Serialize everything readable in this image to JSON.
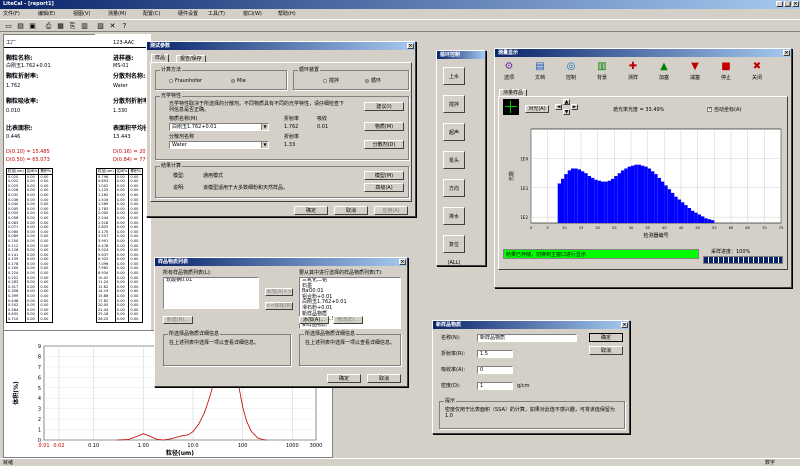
{
  "app": {
    "title": "LiteCal - [report1]",
    "menu": [
      "文件(F)",
      "编辑(E)",
      "视图(V)",
      "测量(M)",
      "配置(C)",
      "硬件设置",
      "工具(T)",
      "窗口(W)",
      "帮助(H)"
    ],
    "statusbar": {
      "left": "就绪",
      "right": "数字"
    },
    "toolbar_icons": [
      "new-icon",
      "open-icon",
      "save-icon",
      "print-icon",
      "preview-icon",
      "copy-icon",
      "paste-icon",
      "report-icon",
      "delete-icon",
      "help-icon"
    ]
  },
  "report": {
    "org": "工厂",
    "sample_id": "123-AAC",
    "sample_name_label": "颗粒名称:",
    "sample_name": "白刚玉1.762+0.01",
    "source_label": "进样器:",
    "source": "MS-01",
    "refr_label": "颗粒折射率:",
    "refr": "1.762",
    "disp_label": "分散剂名称:",
    "disp": "Water",
    "absorb_label": "颗粒吸收率:",
    "absorb": "0.010",
    "disp_refr_label": "分散剂折射率:",
    "disp_refr": "1.330",
    "ssa_label": "比表面积:",
    "ssa": "0.446",
    "surf_label": "表面积平均径:",
    "surf": "13.443",
    "d10": "D(0.10) = 15.485",
    "d16": "D(0.16) = 20.1",
    "d50": "D(0.50) = 65.073",
    "d84": "D(0.84) = 77.6",
    "table_headers": [
      "粒径(um)",
      "区间%",
      "累积%"
    ],
    "table1": [
      [
        "0.020",
        "0.00",
        "0.00"
      ],
      [
        "0.022",
        "0.00",
        "0.00"
      ],
      [
        "0.025",
        "0.00",
        "0.00"
      ],
      [
        "0.028",
        "0.00",
        "0.00"
      ],
      [
        "0.032",
        "0.00",
        "0.00"
      ],
      [
        "0.036",
        "0.00",
        "0.00"
      ],
      [
        "0.040",
        "0.00",
        "0.00"
      ],
      [
        "0.045",
        "0.00",
        "0.00"
      ],
      [
        "0.050",
        "0.00",
        "0.00"
      ],
      [
        "0.056",
        "0.00",
        "0.00"
      ],
      [
        "0.063",
        "0.00",
        "0.00"
      ],
      [
        "0.071",
        "0.00",
        "0.00"
      ],
      [
        "0.080",
        "0.00",
        "0.00"
      ],
      [
        "0.089",
        "0.00",
        "0.00"
      ],
      [
        "0.100",
        "0.00",
        "0.00"
      ],
      [
        "0.112",
        "0.00",
        "0.00"
      ],
      [
        "0.126",
        "0.00",
        "0.00"
      ],
      [
        "0.141",
        "0.00",
        "0.00"
      ],
      [
        "0.159",
        "0.00",
        "0.00"
      ],
      [
        "0.178",
        "0.00",
        "0.00"
      ],
      [
        "0.200",
        "0.00",
        "0.00"
      ],
      [
        "0.224",
        "0.00",
        "0.00"
      ],
      [
        "0.252",
        "0.00",
        "0.00"
      ],
      [
        "0.283",
        "0.00",
        "0.00"
      ],
      [
        "0.317",
        "0.00",
        "0.00"
      ],
      [
        "0.356",
        "0.00",
        "0.00"
      ],
      [
        "0.399",
        "0.00",
        "0.00"
      ],
      [
        "0.448",
        "0.00",
        "0.00"
      ],
      [
        "0.502",
        "0.00",
        "0.00"
      ],
      [
        "0.564",
        "0.00",
        "0.00"
      ],
      [
        "0.632",
        "0.00",
        "0.00"
      ],
      [
        "0.710",
        "0.00",
        "0.00"
      ]
    ],
    "table2": [
      [
        "0.796",
        "0.00",
        "0.00"
      ],
      [
        "0.893",
        "0.00",
        "0.00"
      ],
      [
        "1.002",
        "0.00",
        "0.00"
      ],
      [
        "1.125",
        "0.00",
        "0.00"
      ],
      [
        "1.262",
        "0.00",
        "0.00"
      ],
      [
        "1.416",
        "0.00",
        "0.00"
      ],
      [
        "1.589",
        "0.00",
        "0.00"
      ],
      [
        "1.783",
        "0.00",
        "0.00"
      ],
      [
        "2.000",
        "0.00",
        "0.00"
      ],
      [
        "2.244",
        "0.00",
        "0.00"
      ],
      [
        "2.518",
        "0.00",
        "0.00"
      ],
      [
        "2.825",
        "0.00",
        "0.00"
      ],
      [
        "3.170",
        "0.00",
        "0.00"
      ],
      [
        "3.557",
        "0.00",
        "0.00"
      ],
      [
        "3.991",
        "0.00",
        "0.00"
      ],
      [
        "4.478",
        "0.00",
        "0.00"
      ],
      [
        "5.024",
        "0.00",
        "0.00"
      ],
      [
        "5.637",
        "0.00",
        "0.00"
      ],
      [
        "6.325",
        "0.00",
        "0.00"
      ],
      [
        "7.096",
        "0.00",
        "0.00"
      ],
      [
        "7.962",
        "0.00",
        "0.00"
      ],
      [
        "8.934",
        "0.00",
        "0.00"
      ],
      [
        "10.02",
        "0.00",
        "0.00"
      ],
      [
        "11.24",
        "0.00",
        "0.00"
      ],
      [
        "12.62",
        "0.00",
        "0.00"
      ],
      [
        "14.15",
        "0.00",
        "0.00"
      ],
      [
        "15.88",
        "0.00",
        "0.00"
      ],
      [
        "17.82",
        "0.00",
        "0.00"
      ],
      [
        "20.00",
        "0.00",
        "0.00"
      ],
      [
        "22.44",
        "0.00",
        "0.00"
      ],
      [
        "25.18",
        "0.00",
        "0.00"
      ],
      [
        "28.25",
        "0.00",
        "0.00"
      ]
    ]
  },
  "dist_chart": {
    "ylabel": "体积(%)",
    "xlabel": "粒径(um)",
    "xticks": [
      "0.01",
      "0.02",
      "0.10",
      "1.00",
      "10.0",
      "100",
      "1000",
      "3000"
    ],
    "yticks": [
      "0",
      "1",
      "2",
      "3",
      "4",
      "5",
      "6",
      "7",
      "8",
      "9"
    ]
  },
  "chart_data": {
    "type": "area",
    "title": "",
    "xlabel": "粒径(um)",
    "ylabel": "体积(%)",
    "xscale": "log",
    "xlim": [
      0.01,
      3000
    ],
    "ylim": [
      0,
      9
    ],
    "x": [
      0.3,
      0.5,
      0.8,
      1.0,
      1.3,
      1.8,
      2.5,
      3.5,
      5,
      6,
      8,
      10,
      13,
      17,
      22,
      28,
      35,
      45,
      55,
      65,
      75,
      85,
      100,
      120,
      150,
      200,
      250,
      300
    ],
    "y": [
      0,
      0.05,
      0.4,
      0.6,
      0.4,
      0.1,
      0,
      0.1,
      0.3,
      0.4,
      0.5,
      0.8,
      1.5,
      2.6,
      4.2,
      6.0,
      7.4,
      8.2,
      8.2,
      7.6,
      6.4,
      5.0,
      3.2,
      1.8,
      0.8,
      0.2,
      0.05,
      0
    ]
  },
  "test_params": {
    "title": "测试参数",
    "tabs": [
      "样品",
      "报告/保存"
    ],
    "calc_group": "计算方法",
    "fraunhofer": "Fraunhofer",
    "mie": "Mie",
    "loop_group": "循环装置",
    "loop_opt1": "搅拌",
    "loop_opt2": "循环",
    "optical_group": "光学特性",
    "optical_desc": "光学特性取决于所选择的分散剂。不同物质具有不同的光学特性，请仔细检查下列信息是否正确。",
    "suggest_btn": "建议(I)",
    "material_label": "物质名称(M)",
    "material": "白刚玉1.762+0.01",
    "refr_label": "折射率",
    "refr": "1.762",
    "abs_label": "吸收",
    "abs": "0.01",
    "material_btn": "物质(M)",
    "dispersant_label": "分散剂名称",
    "dispersant": "Water",
    "disp_refr_label": "折射率",
    "disp_refr": "1.33",
    "dispersant_btn": "分散剂(D)",
    "result_group": "结果计算",
    "model_label": "模型:",
    "model": "通用模式",
    "model_btn": "模型(M)",
    "desc_label": "说明:",
    "desc": "该模型适用于大多数细粉和天然样品。",
    "advanced_btn": "高级(A)",
    "ok": "确定",
    "cancel": "取消",
    "apply": "应用(A)"
  },
  "sample_list": {
    "title": "样品物质列表",
    "all_label": "所有样品物质列表(L):",
    "all_items": [
      "软酸钠0.01"
    ],
    "selected_label": "要从其中进行选择的样品物质列表(T):",
    "selected_items": [
      "三氧化二铝",
      "石墨",
      "BaO0.01",
      "铝合粉+0.01",
      "白刚玉1.762+0.01",
      "滑石粉+0.01",
      "新样品物质",
      "新样品物质1.5",
      "新样品物质"
    ],
    "add_btn": "添加(A)>>",
    "remove_btn": "<<移除(R)",
    "new_btn": "新建(N)...",
    "add2_btn": "添加(A)...",
    "edit_btn": "修改(E)...",
    "all_info_group": "所选择品物质详细信息",
    "all_info": "在上述列表中选择一项以查看详细信息。",
    "sel_info_group": "所选择品物质详细信息",
    "sel_info": "在上述列表中选择一项以查看详细信息。",
    "ok": "确定",
    "cancel": "取消"
  },
  "loop_control": {
    "title": "循环控制",
    "buttons": [
      "上水",
      "搅拌",
      "超声",
      "泵头",
      "方向",
      "排水",
      "复位(ALL)"
    ]
  },
  "measure": {
    "title": "测量显示",
    "tools": [
      {
        "label": "选项",
        "icon": "options-icon",
        "color": "#7030a0"
      },
      {
        "label": "文档",
        "icon": "document-icon",
        "color": "#2060c0"
      },
      {
        "label": "控制",
        "icon": "control-icon",
        "color": "#0070c0"
      },
      {
        "label": "背景",
        "icon": "background-icon",
        "color": "#008000"
      },
      {
        "label": "测样",
        "icon": "measure-icon",
        "color": "#c00000"
      },
      {
        "label": "加塞",
        "icon": "add-icon",
        "color": "#008000"
      },
      {
        "label": "减塞",
        "icon": "subtract-icon",
        "color": "#c00000"
      },
      {
        "label": "停止",
        "icon": "stop-icon",
        "color": "#c00000"
      },
      {
        "label": "关闭",
        "icon": "close-icon",
        "color": "#c00000"
      }
    ],
    "tab": "测量样品",
    "align_btn": "对光(A)",
    "concentration": "遮光率光度 = 33.49%",
    "auto_adjust": "自动坐标(A)",
    "ylabel": "光能",
    "xlabel": "检测器编号",
    "yticks": [
      "1E4",
      "1E3",
      "1E2"
    ],
    "xticks": [
      "0",
      "5",
      "10",
      "15",
      "20",
      "25",
      "30",
      "35",
      "40",
      "45",
      "50",
      "55",
      "60",
      "65",
      "70",
      "75"
    ],
    "status": "结果已存储，切换到主窗口进行显示",
    "progress_label": "采样进度：100%",
    "progress": 1.0
  },
  "energy_data": {
    "detectors": [
      8,
      9,
      10,
      11,
      12,
      13,
      14,
      15,
      16,
      17,
      18,
      19,
      20,
      21,
      22,
      23,
      24,
      25,
      26,
      27,
      28,
      29,
      30,
      31,
      32,
      33,
      34,
      35,
      36,
      37,
      38,
      39,
      40,
      41,
      42,
      43,
      44,
      45,
      46,
      47,
      48,
      49,
      50,
      51,
      52,
      53,
      54
    ],
    "values": [
      0.42,
      0.47,
      0.52,
      0.56,
      0.58,
      0.58,
      0.57,
      0.55,
      0.53,
      0.5,
      0.48,
      0.46,
      0.45,
      0.44,
      0.44,
      0.45,
      0.47,
      0.5,
      0.53,
      0.56,
      0.58,
      0.6,
      0.61,
      0.62,
      0.62,
      0.61,
      0.6,
      0.58,
      0.55,
      0.52,
      0.48,
      0.44,
      0.4,
      0.36,
      0.32,
      0.28,
      0.25,
      0.22,
      0.19,
      0.16,
      0.13,
      0.11,
      0.09,
      0.07,
      0.05,
      0.04,
      0.03
    ]
  },
  "new_material": {
    "title": "新样品物质",
    "name_label": "名称(N):",
    "name": "新样品物质",
    "refr_label": "折射率(R):",
    "refr": "1.5",
    "abs_label": "吸收率(A):",
    "abs": "0",
    "density_label": "密度(D):",
    "density": "1",
    "density_unit": "g/cm",
    "hint_group": "提示",
    "hint": "密度仅用于比表面积（SSA）的计算，如果对此值不感兴趣，可将该值保留为1.0",
    "ok": "确定",
    "cancel": "取消"
  }
}
